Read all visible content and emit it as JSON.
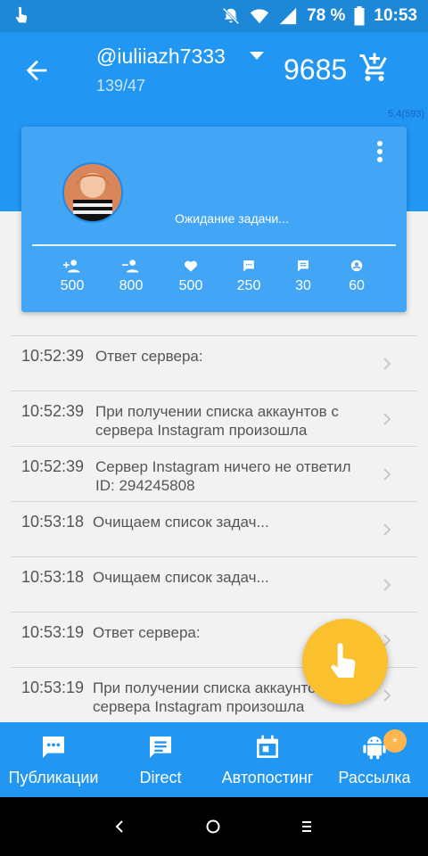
{
  "status_bar": {
    "battery": "78 %",
    "time": "10:53"
  },
  "header": {
    "account": "@iuliiazh7333",
    "counts": "139/47",
    "balance": "9685"
  },
  "version": "5.4(593)",
  "card": {
    "status": "Ожидание задачи...",
    "stats": [
      {
        "icon": "follow-add-icon",
        "value": "500"
      },
      {
        "icon": "unfollow-icon",
        "value": "800"
      },
      {
        "icon": "heart-icon",
        "value": "500"
      },
      {
        "icon": "comment-icon",
        "value": "250"
      },
      {
        "icon": "message-icon",
        "value": "30"
      },
      {
        "icon": "account-circle-icon",
        "value": "60"
      }
    ]
  },
  "log": [
    {
      "time": "10:52:39",
      "msg": "Ответ сервера:"
    },
    {
      "time": "10:52:39",
      "msg": "При получении списка аккаунтов с сервера Instagram произошла"
    },
    {
      "time": "10:52:39",
      "msg": "Сервер Instagram ничего не ответил ID: 294245808"
    },
    {
      "time": "10:53:18",
      "msg": "Очищаем список задач..."
    },
    {
      "time": "10:53:18",
      "msg": "Очищаем список задач..."
    },
    {
      "time": "10:53:19",
      "msg": "Ответ сервера:"
    },
    {
      "time": "10:53:19",
      "msg": "При получении списка аккаунтов с сервера Instagram произошла"
    }
  ],
  "bottom_nav": [
    {
      "label": "Публикации",
      "icon": "publications-icon"
    },
    {
      "label": "Direct",
      "icon": "direct-icon"
    },
    {
      "label": "Автопостинг",
      "icon": "calendar-icon"
    },
    {
      "label": "Рассылка",
      "icon": "android-icon"
    }
  ],
  "badge": "*",
  "colors": {
    "primary": "#2196f3",
    "card": "#42a5f5",
    "fab": "#fbc02d",
    "badge": "#ffb74d"
  }
}
